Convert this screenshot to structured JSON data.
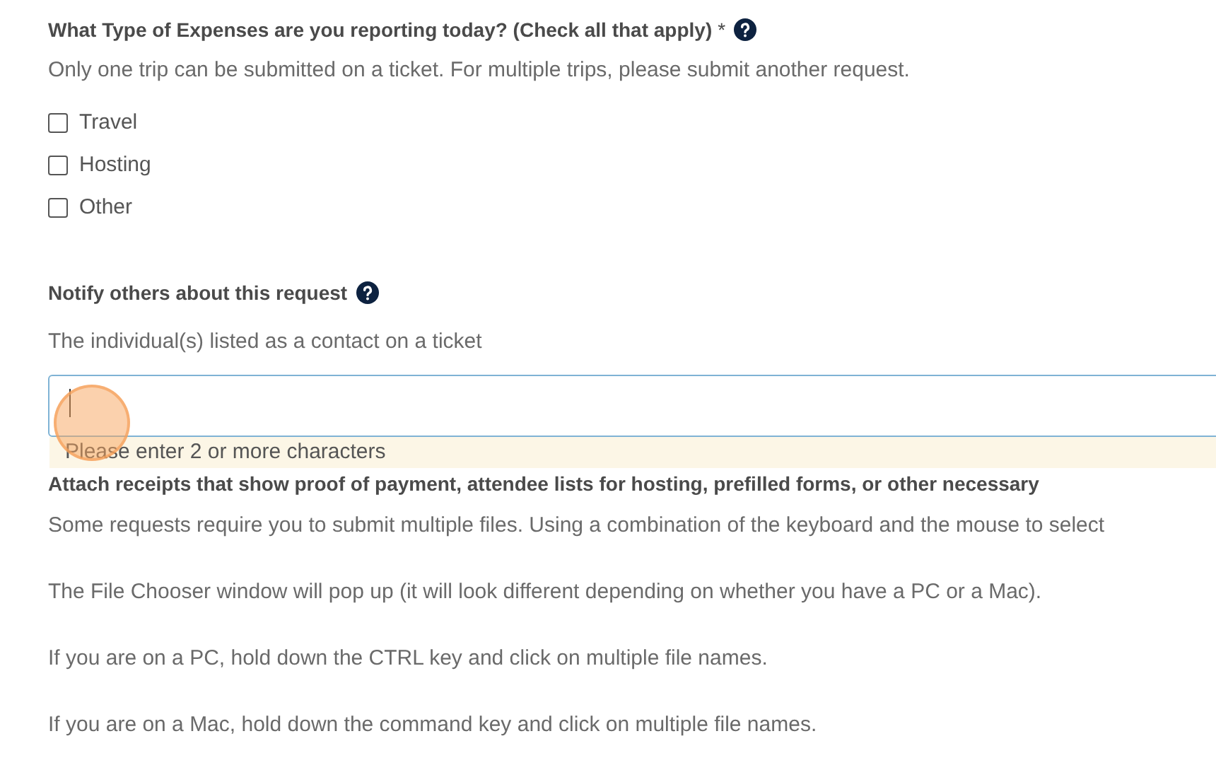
{
  "expense_question": {
    "label": "What Type of Expenses are you reporting today? (Check all that apply)",
    "required_mark": "*",
    "help": "Only one trip can be submitted on a ticket. For multiple trips, please submit another request.",
    "options": [
      {
        "label": "Travel",
        "checked": false
      },
      {
        "label": "Hosting",
        "checked": false
      },
      {
        "label": "Other",
        "checked": false
      }
    ]
  },
  "notify": {
    "label": "Notify others about this request",
    "help": "The individual(s) listed as a contact on a ticket",
    "dropdown_message": "Please enter 2 or more characters"
  },
  "attach": {
    "label": "Attach receipts that show proof of payment, attendee lists for hosting, prefilled forms, or other necessary",
    "paragraphs": [
      "Some requests require you to submit multiple files. Using a combination of the keyboard and the mouse to select",
      "The File Chooser window will pop up (it will look different depending on whether you have a PC or a Mac).",
      "If you are on a PC, hold down the CTRL key and click on multiple file names.",
      "If you are on a Mac, hold down the command key and click on multiple file names."
    ]
  }
}
